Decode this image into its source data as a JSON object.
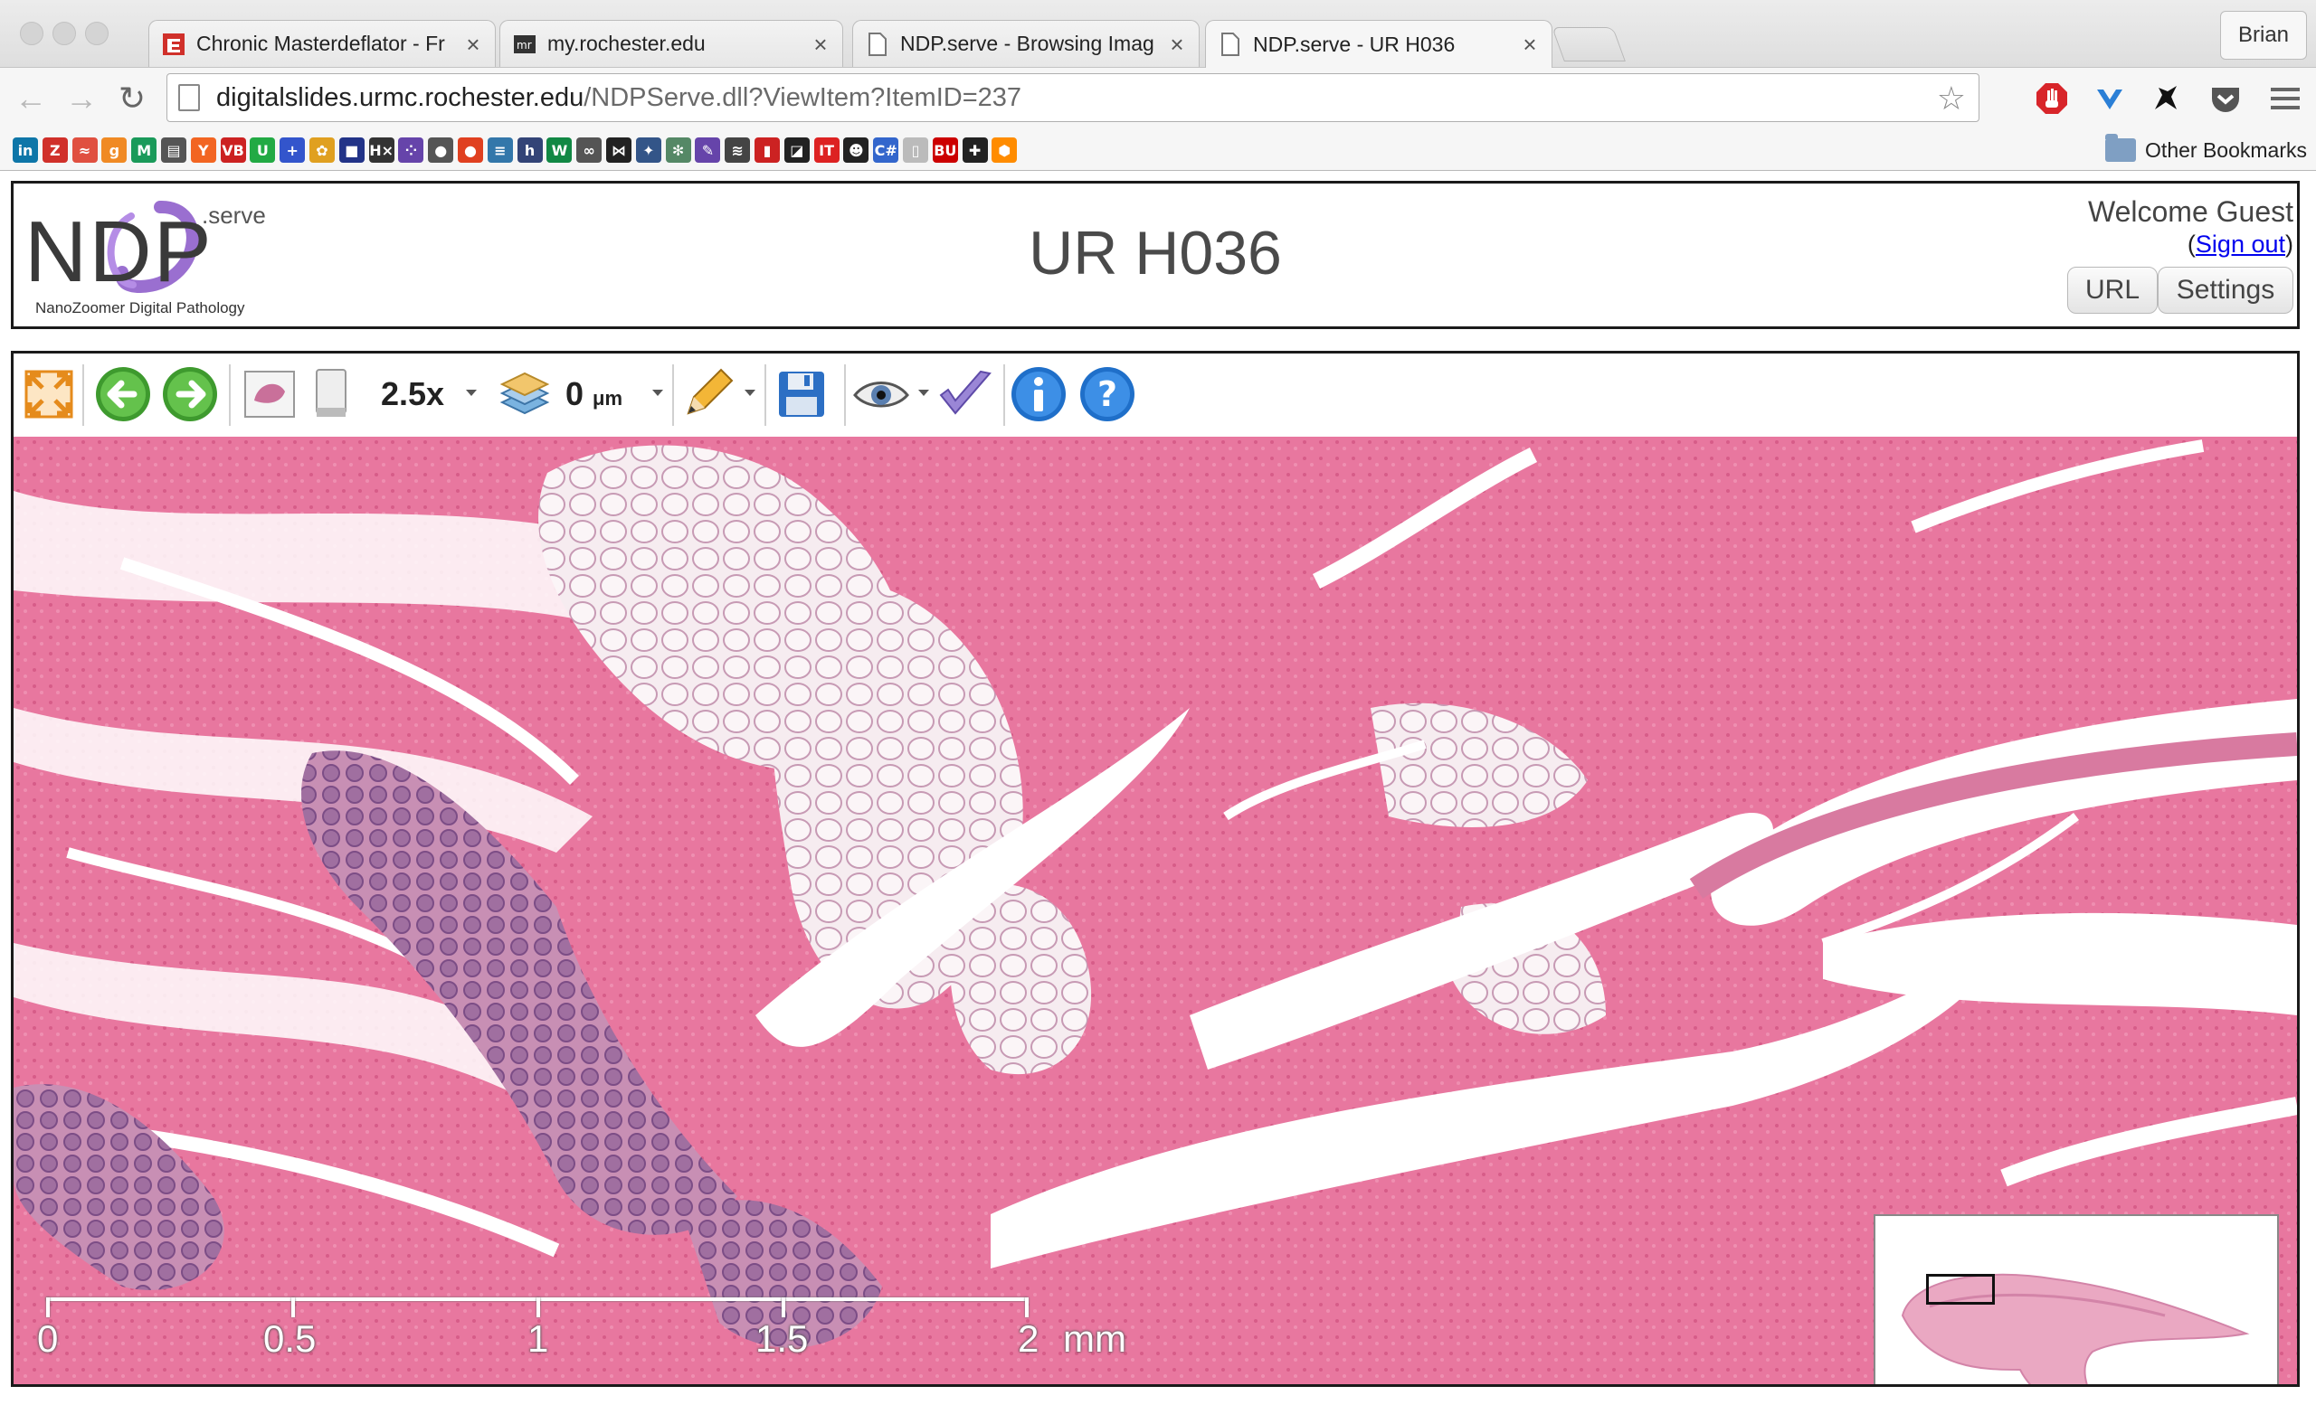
{
  "browser": {
    "tabs": [
      {
        "title": "Chronic Masterdeflator - Fr",
        "favicon": "red-zen-icon",
        "active": false
      },
      {
        "title": "my.rochester.edu",
        "favicon": "mr-icon",
        "active": false
      },
      {
        "title": "NDP.serve - Browsing Imag",
        "favicon": "page-icon",
        "active": false
      },
      {
        "title": "NDP.serve - UR H036",
        "favicon": "page-icon",
        "active": true
      }
    ],
    "close_glyph": "×",
    "profile_name": "Brian",
    "url_host": "digitalslides.urmc.rochester.edu",
    "url_path": "/NDPServe.dll?ViewItem?ItemID=237",
    "other_bookmarks": "Other Bookmarks",
    "bookmarks": [
      {
        "label": "in",
        "icon": "linkedin-icon",
        "color": "#0e76a8"
      },
      {
        "label": "Z",
        "icon": "zen-icon",
        "color": "#d0302a"
      },
      {
        "label": "≈",
        "icon": "stack-icon",
        "color": "#e05040"
      },
      {
        "label": "g",
        "icon": "goodreads-icon",
        "color": "#f08a24"
      },
      {
        "label": "M",
        "icon": "m-icon",
        "color": "#1a9a5a"
      },
      {
        "label": "▤",
        "icon": "news-icon",
        "color": "#555555"
      },
      {
        "label": "Y",
        "icon": "ycombinator-icon",
        "color": "#f26522"
      },
      {
        "label": "VB",
        "icon": "vb-icon",
        "color": "#cc2222"
      },
      {
        "label": "U",
        "icon": "u-icon",
        "color": "#22aa44"
      },
      {
        "label": "+",
        "icon": "plus-icon",
        "color": "#3355cc"
      },
      {
        "label": "✿",
        "icon": "flower-icon",
        "color": "#e0a020"
      },
      {
        "label": "■",
        "icon": "grid-icon",
        "color": "#223388"
      },
      {
        "label": "H×",
        "icon": "hx-icon",
        "color": "#333333"
      },
      {
        "label": "⁘",
        "icon": "dots-icon",
        "color": "#6644aa"
      },
      {
        "label": "●",
        "icon": "appress-icon",
        "color": "#555555"
      },
      {
        "label": "●",
        "icon": "tomato-icon",
        "color": "#e04020"
      },
      {
        "label": "≡",
        "icon": "database-icon",
        "color": "#3377aa"
      },
      {
        "label": "h",
        "icon": "h-icon",
        "color": "#334477"
      },
      {
        "label": "W",
        "icon": "w-icon",
        "color": "#118844"
      },
      {
        "label": "∞",
        "icon": "link-icon",
        "color": "#555555"
      },
      {
        "label": "⋈",
        "icon": "bowtie-icon",
        "color": "#222222"
      },
      {
        "label": "✦",
        "icon": "puzzle-icon",
        "color": "#335588"
      },
      {
        "label": "✻",
        "icon": "network-icon",
        "color": "#558866"
      },
      {
        "label": "✎",
        "icon": "feather-icon",
        "color": "#6644aa"
      },
      {
        "label": "≋",
        "icon": "stripes-icon",
        "color": "#444444"
      },
      {
        "label": "▮",
        "icon": "bar-chart-icon",
        "color": "#cc2222"
      },
      {
        "label": "◪",
        "icon": "square-icon",
        "color": "#222222"
      },
      {
        "label": "IT",
        "icon": "it-icon",
        "color": "#dd2222"
      },
      {
        "label": "☻",
        "icon": "face-icon",
        "color": "#222222"
      },
      {
        "label": "C#",
        "icon": "csharp-icon",
        "color": "#3366cc"
      },
      {
        "label": "▯",
        "icon": "doc-icon",
        "color": "#bbbbbb"
      },
      {
        "label": "BU",
        "icon": "bu-icon",
        "color": "#cc0000"
      },
      {
        "label": "✚",
        "icon": "cross-icon",
        "color": "#222222"
      },
      {
        "label": "⬢",
        "icon": "hexagon-icon",
        "color": "#ff8c00"
      }
    ]
  },
  "header": {
    "logo_main": "NDP",
    "logo_serve": ".serve",
    "logo_sub": "NanoZoomer Digital Pathology",
    "title": "UR H036",
    "welcome": "Welcome Guest",
    "signout_open": "(",
    "signout": "Sign out",
    "signout_close": ")",
    "url_button": "URL",
    "settings_button": "Settings"
  },
  "viewer": {
    "zoom": "2.5x",
    "focus_value": "0",
    "focus_unit": "μm",
    "scale_labels": [
      "0",
      "0.5",
      "1",
      "1.5",
      "2"
    ],
    "scale_unit": "mm",
    "colors": {
      "tissue": "#e4799f",
      "fat": "#f6ecf0",
      "gland": "#a87aa8",
      "background": "#ffffff"
    }
  }
}
